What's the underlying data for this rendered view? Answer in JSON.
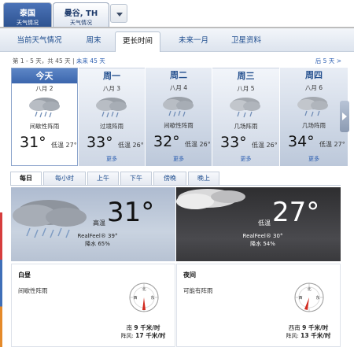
{
  "locations": {
    "inactive": {
      "line1": "泰国",
      "line2": "天气情况"
    },
    "active": {
      "line1": "曼谷, TH",
      "line2": "天气情况"
    }
  },
  "nav": {
    "items": [
      {
        "label": "当前天气情况"
      },
      {
        "label": "周末"
      },
      {
        "label": "更长时间"
      },
      {
        "label": "未来一月"
      },
      {
        "label": "卫星资料"
      }
    ],
    "active_index": 2
  },
  "range": {
    "text": "第 1 - 5 天，共 45 天",
    "separator": "|",
    "link": "未来 45 天",
    "next": "后 5 天 >"
  },
  "days": [
    {
      "name": "今天",
      "date": "八月 2",
      "desc": "间歇性阵雨",
      "hi": "31°",
      "lo": "低温 27°",
      "more": ""
    },
    {
      "name": "周一",
      "date": "八月 3",
      "desc": "过境阵雨",
      "hi": "33°",
      "lo": "低温 26°",
      "more": "更多"
    },
    {
      "name": "周二",
      "date": "八月 4",
      "desc": "间歇性阵雨",
      "hi": "32°",
      "lo": "低温 26°",
      "more": "更多"
    },
    {
      "name": "周三",
      "date": "八月 5",
      "desc": "几场阵雨",
      "hi": "33°",
      "lo": "低温 26°",
      "more": "更多"
    },
    {
      "name": "周四",
      "date": "八月 6",
      "desc": "几场阵雨",
      "hi": "34°",
      "lo": "低温 27°",
      "more": "更多"
    }
  ],
  "period_tabs": [
    "每日",
    "每小时",
    "上午",
    "下午",
    "傍晚",
    "晚上"
  ],
  "day_panel": {
    "hi_label": "高温",
    "temp": "31°",
    "realfeel": "RealFeel® 39°",
    "precip": "降水 65%",
    "title": "白昼",
    "desc": "间歇性阵雨",
    "wind_dir": "南",
    "wind_speed": "9 千米/时",
    "gust_label": "阵风:",
    "gust_speed": "17 千米/时"
  },
  "night_panel": {
    "lo_label": "低温",
    "temp": "27°",
    "realfeel": "RealFeel® 30°",
    "precip": "降水 54%",
    "title": "夜间",
    "desc": "可能有阵雨",
    "wind_dir": "西南",
    "wind_speed": "9 千米/时",
    "gust_label": "阵风:",
    "gust_speed": "13 千米/时"
  },
  "compass_labels": {
    "n": "北",
    "e": "东",
    "s": "南",
    "w": "西"
  }
}
